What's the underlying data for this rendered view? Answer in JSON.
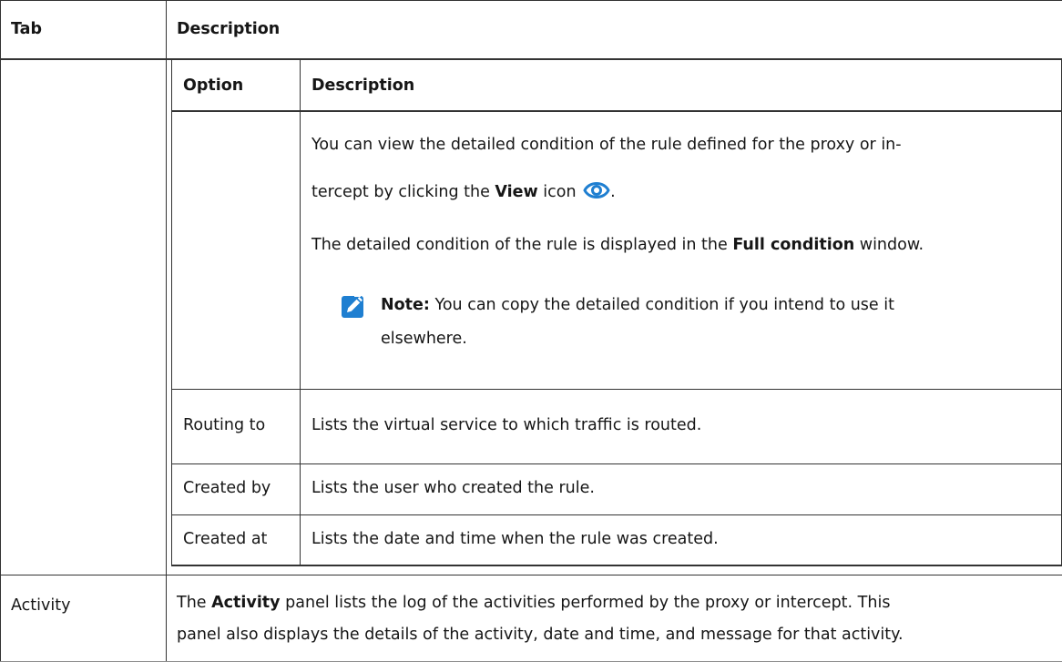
{
  "outer_table": {
    "headers": {
      "tab": "Tab",
      "description": "Description"
    },
    "rows": [
      {
        "tab": "",
        "inner_table": {
          "headers": {
            "option": "Option",
            "description": "Description"
          },
          "condition_row": {
            "option": "",
            "line1": "You can view the detailed condition of the rule defined for the proxy or in-",
            "line2_pre": "tercept by clicking the ",
            "line2_bold": "View",
            "line2_post": " icon",
            "line2_end": ".",
            "view_icon": "eye-icon",
            "full_pre": "The detailed condition of the rule is displayed in the ",
            "full_bold": "Full condition",
            "full_post": " window.",
            "note_icon": "pencil-note-icon",
            "note_label": "Note:",
            "note_line1": " You can copy the detailed condition if you intend to use it",
            "note_line2": "elsewhere."
          },
          "rows": [
            {
              "option": "Routing to",
              "description": "Lists the virtual service to which traffic is routed."
            },
            {
              "option": "Created by",
              "description": "Lists the user who created the rule."
            },
            {
              "option": "Created at",
              "description": "Lists the date and time when the rule was created."
            }
          ]
        }
      },
      {
        "tab": "Activity",
        "desc_pre": "The ",
        "desc_bold": "Activity",
        "desc_line1_post": " panel lists the log of the activities performed by the proxy or intercept. This",
        "desc_line2": "panel also displays the details of the activity, date and time, and message for that activity."
      }
    ]
  },
  "colors": {
    "note_icon": "#1f7fd1",
    "eye_icon": "#1f7fd1",
    "border": "#333333"
  }
}
